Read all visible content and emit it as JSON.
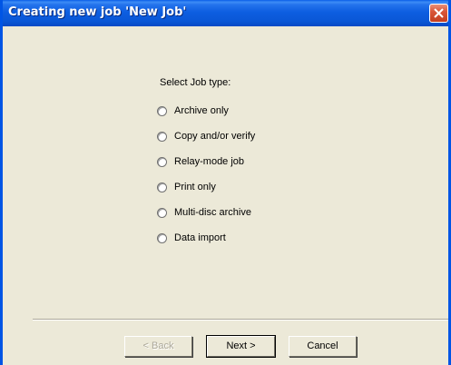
{
  "window": {
    "title": "Creating new job 'New Job'"
  },
  "wizard": {
    "prompt": "Select Job type:",
    "options": [
      {
        "label": "Archive only",
        "selected": false
      },
      {
        "label": "Copy and/or verify",
        "selected": false
      },
      {
        "label": "Relay-mode job",
        "selected": false
      },
      {
        "label": "Print only",
        "selected": false
      },
      {
        "label": "Multi-disc archive",
        "selected": false
      },
      {
        "label": "Data import",
        "selected": false
      }
    ]
  },
  "buttons": {
    "back": "< Back",
    "next": "Next >",
    "cancel": "Cancel"
  },
  "colors": {
    "titlebar": "#0a5ee8",
    "dialog_background": "#ece9d8",
    "close_button": "#d9573a"
  },
  "icons": {
    "close": "close-x-icon"
  }
}
